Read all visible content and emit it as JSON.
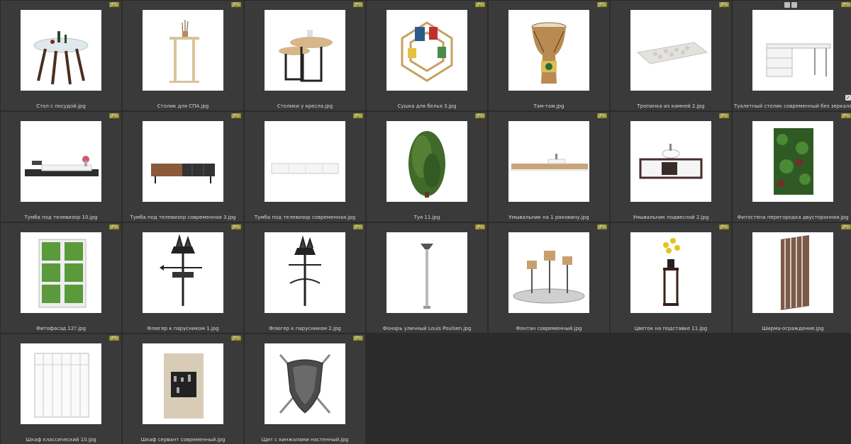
{
  "gallery": {
    "items": [
      {
        "label": "Стол с посудой.jpg",
        "badge": "JPG",
        "icon": "table-with-dishes-icon"
      },
      {
        "label": "Столик для СПА.jpg",
        "badge": "JPG",
        "icon": "spa-side-table-icon"
      },
      {
        "label": "Столики у кресла.jpg",
        "badge": "JPG",
        "icon": "nesting-tables-icon"
      },
      {
        "label": "Сушка для белья 3.jpg",
        "badge": "JPG",
        "icon": "laundry-rack-icon"
      },
      {
        "label": "Там-там.jpg",
        "badge": "JPG",
        "icon": "drum-icon"
      },
      {
        "label": "Тропинка из камней 2.jpg",
        "badge": "JPG",
        "icon": "stone-path-icon"
      },
      {
        "label": "Туалетный столик современный без зеркала.jpg",
        "badge": "JPG",
        "icon": "dressing-table-icon",
        "selected": true
      },
      {
        "label": "Тумба под телевизор 10.jpg",
        "badge": "JPG",
        "icon": "tv-stand-icon"
      },
      {
        "label": "Тумба под телевизор современная 3.jpg",
        "badge": "JPG",
        "icon": "tv-stand-wood-icon"
      },
      {
        "label": "Тумба под телевизор современная.jpg",
        "badge": "JPG",
        "icon": "tv-stand-white-icon"
      },
      {
        "label": "Туя 11.jpg",
        "badge": "JPG",
        "icon": "thuja-tree-icon"
      },
      {
        "label": "Умывальник на 1 раковину.jpg",
        "badge": "JPG",
        "icon": "washbasin-counter-icon"
      },
      {
        "label": "Умывальник подвесной 2.jpg",
        "badge": "JPG",
        "icon": "hanging-washbasin-icon"
      },
      {
        "label": "Фитостена перегородка двусторонняя.jpg",
        "badge": "JPG",
        "icon": "green-wall-icon"
      },
      {
        "label": "Фитофасад 12?.jpg",
        "badge": "JPG",
        "icon": "green-facade-icon"
      },
      {
        "label": "Флюгер к парусником 1.jpg",
        "badge": "JPG",
        "icon": "weathervane-ship-icon"
      },
      {
        "label": "Флюгер к парусником 2.jpg",
        "badge": "JPG",
        "icon": "weathervane-ship-2-icon"
      },
      {
        "label": "Фонарь уличный Louis Poulsen.jpg",
        "badge": "JPG",
        "icon": "street-lamp-icon"
      },
      {
        "label": "Фонтан современный.jpg",
        "badge": "JPG",
        "icon": "fountain-icon"
      },
      {
        "label": "Цветок на подставке 11.jpg",
        "badge": "JPG",
        "icon": "flower-on-stand-icon"
      },
      {
        "label": "Ширма-ограждение.jpg",
        "badge": "JPG",
        "icon": "screen-fence-icon"
      },
      {
        "label": "Шкаф классический 10.jpg",
        "badge": "JPG",
        "icon": "classic-wardrobe-icon"
      },
      {
        "label": "Шкаф сервант современный.jpg",
        "badge": "JPG",
        "icon": "modern-sideboard-icon"
      },
      {
        "label": "Щит с кинжалами настенный.jpg",
        "badge": "JPG",
        "icon": "shield-daggers-icon"
      }
    ]
  },
  "colors": {
    "background": "#2b2b2b",
    "cell": "#3a3a3a",
    "badge": "#8f8b2f",
    "label": "#d8d8d8"
  }
}
